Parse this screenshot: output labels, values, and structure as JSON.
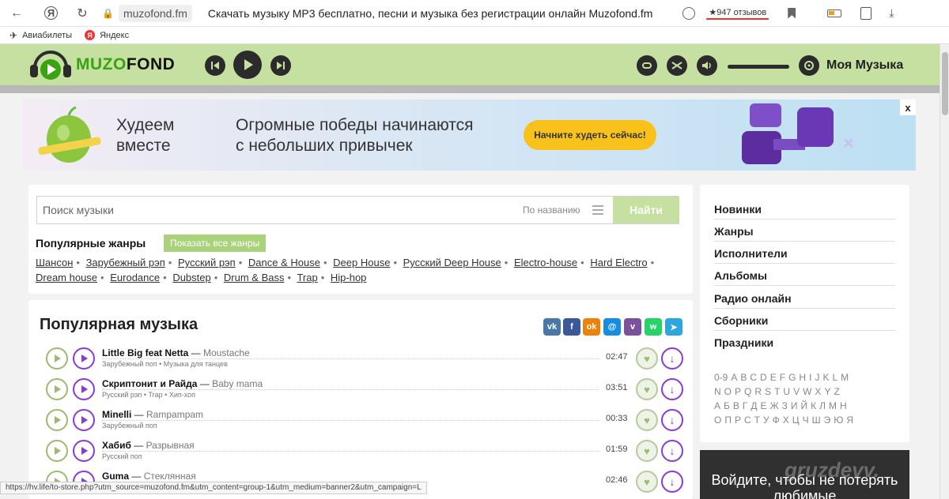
{
  "browser": {
    "url": "muzofond.fm",
    "title": "Скачать музыку MP3 бесплатно, песни и музыка без регистрации онлайн Muzofond.fm",
    "reviews": "★947 отзывов",
    "bookmarks": [
      "Авиабилеты",
      "Яндекс"
    ]
  },
  "header": {
    "logo_muzo": "MUZO",
    "logo_fond": "FOND",
    "my_music": "Моя Музыка"
  },
  "banner": {
    "line1a": "Худеем",
    "line1b": "вместе",
    "line2a": "Огромные победы начинаются",
    "line2b": "с небольших привычек",
    "cta": "Начните худеть сейчас!",
    "close": "x"
  },
  "search": {
    "placeholder": "Поиск музыки",
    "mode": "По названию",
    "button": "Найти"
  },
  "genres": {
    "heading": "Популярные жанры",
    "show_all": "Показать все жанры",
    "row1": [
      "Шансон",
      "Зарубежный рэп",
      "Русский рэп",
      "Dance & House",
      "Deep House",
      "Русский Deep House",
      "Electro-house",
      "Hard Electro"
    ],
    "row2": [
      "Dream house",
      "Eurodance",
      "Dubstep",
      "Drum & Bass",
      "Trap",
      "Hip-hop"
    ]
  },
  "popular": {
    "title": "Популярная музыка",
    "share_icons": [
      "vk-icon",
      "facebook-icon",
      "odnoklassniki-icon",
      "moimir-icon",
      "viber-icon",
      "whatsapp-icon",
      "telegram-icon"
    ],
    "tracks": [
      {
        "artist": "Little Big feat Netta",
        "song": "Moustache",
        "tags": "Зарубежный поп • Музыка для танцев",
        "duration": "02:47"
      },
      {
        "artist": "Скриптонит и Райда",
        "song": "Baby mama",
        "tags": "Русский рэп • Trap • Хип-хоп",
        "duration": "03:51"
      },
      {
        "artist": "Minelli",
        "song": "Rampampam",
        "tags": "Зарубежный поп",
        "duration": "00:33"
      },
      {
        "artist": "Хабиб",
        "song": "Разрывная",
        "tags": "Русский поп",
        "duration": "01:59"
      },
      {
        "artist": "Guma",
        "song": "Стеклянная",
        "tags": "",
        "duration": "02:46"
      }
    ]
  },
  "sidebar": {
    "items": [
      "Новинки",
      "Жанры",
      "Исполнители",
      "Альбомы",
      "Радио онлайн",
      "Сборники",
      "Праздники"
    ],
    "alpha_rows": [
      [
        "0-9",
        "A",
        "B",
        "C",
        "D",
        "E",
        "F",
        "G",
        "H",
        "I",
        "J",
        "K",
        "L",
        "M"
      ],
      [
        "N",
        "O",
        "P",
        "Q",
        "R",
        "S",
        "T",
        "U",
        "V",
        "W",
        "X",
        "Y",
        "Z"
      ],
      [
        "А",
        "Б",
        "В",
        "Г",
        "Д",
        "Е",
        "Ж",
        "З",
        "И",
        "Й",
        "К",
        "Л",
        "М",
        "Н"
      ],
      [
        "О",
        "П",
        "Р",
        "С",
        "Т",
        "У",
        "Ф",
        "Х",
        "Ц",
        "Ч",
        "Ш",
        "Э",
        "Ю",
        "Я"
      ]
    ],
    "login_text": "Войдите, чтобы не потерять любимые"
  },
  "watermark": "gruzdevv.",
  "status_url": "https://hv.life/to-store.php?utm_source=muzofond.fm&utm_content=group-1&utm_medium=banner2&utm_campaign=L"
}
